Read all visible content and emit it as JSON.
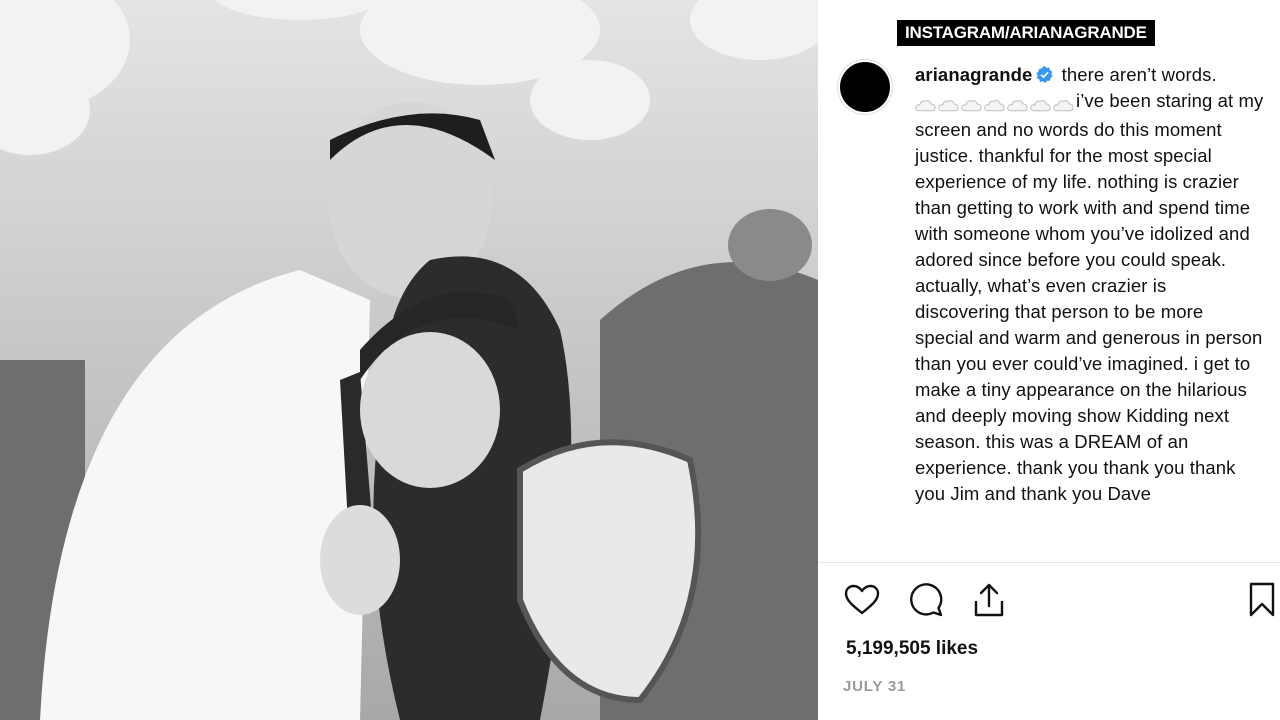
{
  "source": "INSTAGRAM/ARIANAGRANDE",
  "post": {
    "username": "arianagrande",
    "verified": true,
    "caption_first": "there aren’t words.",
    "emoji_count": 7,
    "emoji_icon": "cloud-icon",
    "caption_rest": "i’ve been staring at my screen and no words do this moment justice. thankful for the most special experience of my life. nothing is crazier than getting to work with and spend time with someone whom you’ve idolized and adored since before you could speak. actually, what’s even crazier is discovering that person to be more special and warm and generous in person than you ever could’ve imagined. i get to make a tiny appearance on the hilarious and deeply moving show Kidding next season. this was a DREAM of an experience. thank you thank you thank you Jim and thank you Dave",
    "likes": "5,199,505 likes",
    "date": "JULY 31"
  },
  "actions": {
    "like_icon": "heart-icon",
    "comment_icon": "comment-icon",
    "share_icon": "share-icon",
    "save_icon": "bookmark-icon"
  },
  "colors": {
    "verified_blue": "#3897f0",
    "photo_tint": "#bdbdbd"
  }
}
